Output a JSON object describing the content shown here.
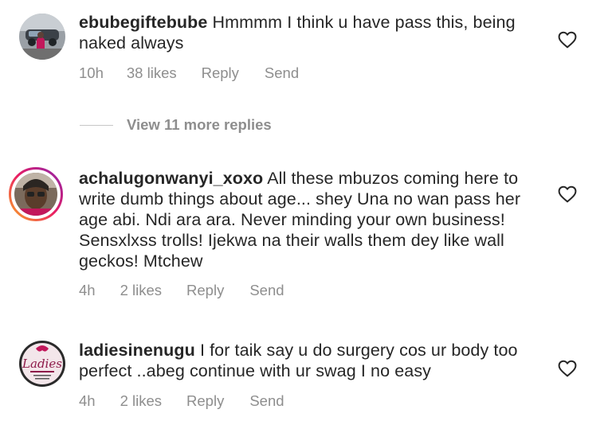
{
  "comments": [
    {
      "username": "ebubegiftebube",
      "text": "Hmmmm I think u have pass this, being naked always",
      "time": "10h",
      "likes": "38 likes",
      "reply": "Reply",
      "send": "Send"
    },
    {
      "username": "achalugonwanyi_xoxo",
      "text": "All these mbuzos coming here to write dumb things about age... shey Una no wan pass her age abi. Ndi ara ara. Never minding your own business! Sensxlxss trolls! Ijekwa na their walls them dey like wall geckos! Mtchew",
      "time": "4h",
      "likes": "2 likes",
      "reply": "Reply",
      "send": "Send"
    },
    {
      "username": "ladiesinenugu",
      "text": "I for taik say u do surgery cos ur body too perfect ..abeg continue with ur swag I no easy",
      "time": "4h",
      "likes": "2 likes",
      "reply": "Reply",
      "send": "Send",
      "avatar_text": "Ladies"
    }
  ],
  "view_replies": "View 11 more replies",
  "colors": {
    "text": "#262626",
    "meta": "#8e8e8e",
    "story_ring_start": "#f9a825",
    "story_ring_end": "#d81b60"
  },
  "icons": [
    "heart-icon"
  ]
}
